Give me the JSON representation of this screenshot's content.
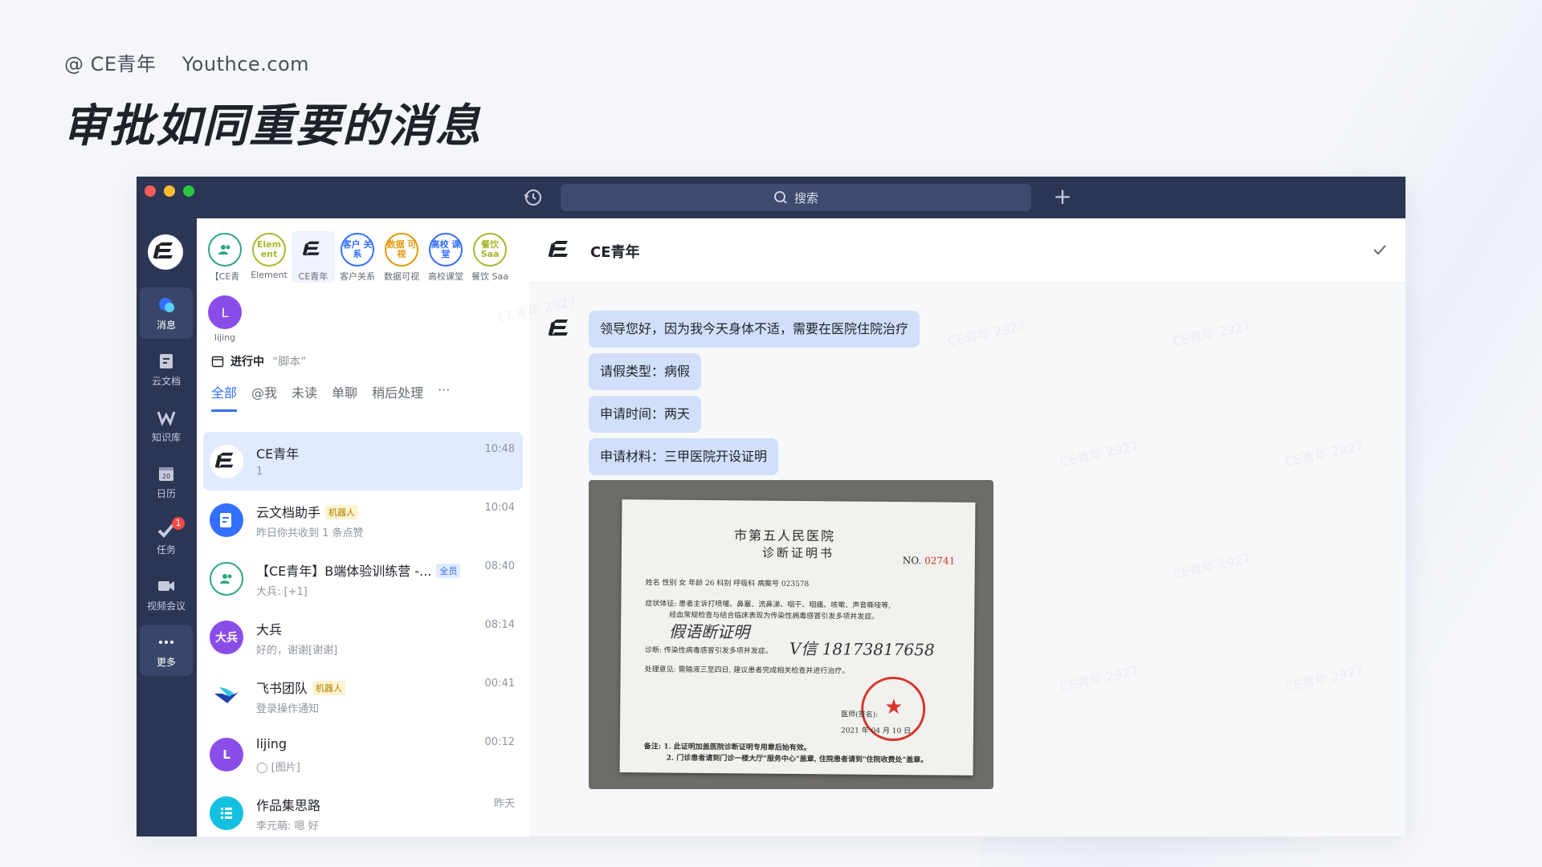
{
  "brand": {
    "handle": "@ CE青年",
    "site": "Youthce.com"
  },
  "slide_title": "审批如同重要的消息",
  "search": {
    "placeholder": "搜索"
  },
  "nav": [
    {
      "label": "消息"
    },
    {
      "label": "云文档"
    },
    {
      "label": "知识库"
    },
    {
      "label": "日历"
    },
    {
      "label": "任务",
      "badge": "1"
    },
    {
      "label": "视频会议"
    },
    {
      "label": "更多"
    }
  ],
  "pins": [
    {
      "label": "【CE青",
      "text": "",
      "color": "#2ea87e"
    },
    {
      "label": "Element",
      "text": "Elem ent",
      "color": "#a8b82a"
    },
    {
      "label": "CE青年",
      "text": "",
      "color": "#1f2329"
    },
    {
      "label": "客户关系",
      "text": "客户 关系",
      "color": "#3370ff"
    },
    {
      "label": "数据可视",
      "text": "数据 可视",
      "color": "#e39a0c"
    },
    {
      "label": "高校课堂",
      "text": "高校 课堂",
      "color": "#3370ff"
    },
    {
      "label": "餐饮 Saa",
      "text": "餐饮 Saa",
      "color": "#a8b82a"
    }
  ],
  "pin_user": {
    "initial": "L",
    "label": "lijing"
  },
  "in_progress": {
    "label": "进行中",
    "quote": "“脚本”"
  },
  "filters": [
    "全部",
    "@我",
    "未读",
    "单聊",
    "稍后处理",
    "···"
  ],
  "chats": [
    {
      "name": "CE青年",
      "sub": "1",
      "time": "10:48",
      "avatar": "ce",
      "color": "#ffffff",
      "tag": ""
    },
    {
      "name": "云文档助手",
      "sub": "昨日你共收到 1 条点赞",
      "time": "10:04",
      "avatar": "doc",
      "color": "#3370ff",
      "tag": "机器人"
    },
    {
      "name": "【CE青年】B端体验训练营 -...",
      "sub": "大兵: [+1]",
      "time": "08:40",
      "avatar": "group",
      "color": "#ffffff",
      "tag": "全员"
    },
    {
      "name": "大兵",
      "sub": "好的，谢谢[谢谢]",
      "time": "08:14",
      "avatar": "大兵",
      "color": "#8a4ee8",
      "tag": ""
    },
    {
      "name": "飞书团队",
      "sub": "登录操作通知",
      "time": "00:41",
      "avatar": "feishu",
      "color": "#ffffff",
      "tag": "机器人"
    },
    {
      "name": "lijing",
      "sub": "◯ [图片]",
      "time": "00:12",
      "avatar": "L",
      "color": "#8a4ee8",
      "tag": ""
    },
    {
      "name": "作品集思路",
      "sub": "李元萌: 嗯 好",
      "time": "昨天",
      "avatar": "list",
      "color": "#14c0e0",
      "tag": ""
    }
  ],
  "chat": {
    "title": "CE青年",
    "messages": [
      "领导您好，因为我今天身体不适，需要在医院住院治疗",
      "请假类型：病假",
      "申请时间：两天",
      "申请材料：三甲医院开设证明"
    ]
  },
  "certificate": {
    "hospital": "市第五人民医院",
    "doc_title": "诊断证明书",
    "no_label": "NO.",
    "no_value": "02741",
    "patient_line": "姓名            性别  女  年龄  26   科别     呼吸科      病案号  023578",
    "symptom_line": "症状体征: 患者主诉打喷嚏、鼻塞、流鼻涕、咽干、咽痛、咳嗽、声音嘶哑等,",
    "symptom_line2": "经血常规检查与结合临床表现为传染性病毒感冒引发多项并发症。",
    "diag_line": "诊断: 传染性病毒感冒引发多项并发症。",
    "advice_line": "处理意见:  需输液三至四日, 建议患者完成相关检查并进行治疗。",
    "doctor_line": "医师(签名):",
    "date_line": "2021 年 04 月 10 日",
    "note_line1": "备注: 1. 此证明加盖医院诊断证明专用章后始有效。",
    "note_line2": "2. 门诊患者请到门诊一楼大厅\"服务中心\"盖章, 住院患者请到\"住院收费处\"盖章。",
    "hand1": "假语断证明",
    "hand2": "V信  18173817658"
  },
  "watermark_text": "CE青年 2927"
}
